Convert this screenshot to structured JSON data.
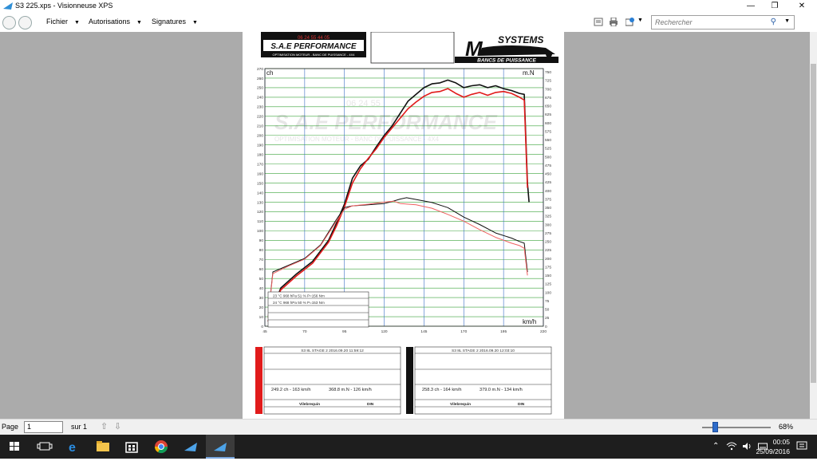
{
  "window": {
    "title": "S3 225.xps - Visionneuse XPS",
    "min_glyph": "—",
    "max_glyph": "❐",
    "close_glyph": "✕"
  },
  "menu": {
    "items": [
      {
        "label": "Fichier"
      },
      {
        "label": "Autorisations"
      },
      {
        "label": "Signatures"
      }
    ],
    "search_placeholder": "Rechercher"
  },
  "status": {
    "page_label": "Page",
    "page_value": "1",
    "of_label": "sur 1",
    "zoom": "68%"
  },
  "taskbar": {
    "time": "00:05",
    "date": "25/09/2016"
  },
  "document": {
    "logo_left_phone": "06 24 55 44 05",
    "logo_left_name": "S.A.E PERFORMANCE",
    "logo_left_sub": "OPTIMISATION MOTEUR - BANC DE PUISSANCE - 4X4",
    "logo_right_name": "SYSTEMS",
    "logo_right_sub": "BANCS DE PUISSANCE",
    "watermark_phone": "06 24 55",
    "watermark_name": "S.A.E PERFORMANCE",
    "watermark_sub": "OPTIMISATION MOTEUR - BANC DE PUISSANCE - 4X4",
    "conditions": [
      {
        "text": "23 °C    968 hPa    51 %      P=156 Nm"
      },
      {
        "text": "24 °C    968 hPa    50 %      P=153 Nm"
      }
    ],
    "run_cards": [
      {
        "color": "#e11b1b",
        "header": "S3 8L STAGE 2    2016.09.20 11:59:12",
        "result_power": "249.2 ch - 163 km/h",
        "result_torque": "368.8 m.N - 126 km/h",
        "footer_left": "Vilebrequin",
        "footer_right": "DIN"
      },
      {
        "color": "#111111",
        "header": "S3 8L STAGE 2    2016.09.20 12:03:10",
        "result_power": "258.3 ch - 164 km/h",
        "result_torque": "379.0 m.N - 134 km/h",
        "footer_left": "Vilebrequin",
        "footer_right": "DIN"
      }
    ]
  },
  "chart_data": {
    "type": "line",
    "xlabel": "km/h",
    "ylabel_left": "ch",
    "ylabel_right": "m.N",
    "xlim": [
      45,
      220
    ],
    "ylim_left": [
      0,
      270
    ],
    "ylim_right": [
      0,
      760
    ],
    "x_ticks": [
      45,
      70,
      95,
      120,
      145,
      170,
      195,
      220
    ],
    "y_ticks_left": [
      0,
      10,
      20,
      30,
      40,
      50,
      60,
      70,
      80,
      90,
      100,
      110,
      120,
      130,
      140,
      150,
      160,
      170,
      180,
      190,
      200,
      210,
      220,
      230,
      240,
      250,
      260,
      270
    ],
    "y_ticks_right": [
      0,
      25,
      50,
      75,
      100,
      125,
      150,
      175,
      200,
      225,
      250,
      275,
      300,
      325,
      350,
      375,
      400,
      425,
      450,
      475,
      500,
      525,
      550,
      575,
      600,
      625,
      650,
      675,
      700,
      725,
      750
    ],
    "grid": true,
    "series": [
      {
        "name": "258.3 ch",
        "axis": "left",
        "color": "#111111",
        "x": [
          47,
          55,
          65,
          75,
          85,
          90,
          95,
          100,
          105,
          110,
          115,
          120,
          125,
          130,
          135,
          140,
          145,
          150,
          155,
          160,
          165,
          170,
          175,
          180,
          185,
          190,
          195,
          200,
          205,
          208,
          210,
          211
        ],
        "values": [
          5,
          40,
          55,
          68,
          90,
          108,
          128,
          155,
          168,
          175,
          188,
          200,
          210,
          223,
          236,
          243,
          250,
          254,
          255,
          258,
          255,
          250,
          252,
          253,
          250,
          252,
          249,
          247,
          244,
          243,
          150,
          130
        ]
      },
      {
        "name": "249.2 ch",
        "axis": "left",
        "color": "#e11b1b",
        "x": [
          47,
          55,
          65,
          75,
          85,
          90,
          95,
          100,
          105,
          110,
          115,
          120,
          125,
          130,
          135,
          140,
          145,
          150,
          155,
          160,
          165,
          170,
          175,
          180,
          185,
          190,
          195,
          200,
          205,
          208,
          210
        ],
        "values": [
          5,
          38,
          53,
          66,
          88,
          105,
          125,
          150,
          165,
          176,
          186,
          198,
          208,
          218,
          228,
          235,
          241,
          245,
          246,
          249,
          244,
          240,
          243,
          245,
          242,
          245,
          246,
          244,
          240,
          237,
          145
        ]
      },
      {
        "name": "379.0 m.N",
        "axis": "right",
        "color": "#111111",
        "x": [
          47,
          50,
          60,
          70,
          80,
          90,
          95,
          100,
          110,
          120,
          125,
          130,
          134,
          140,
          150,
          160,
          170,
          180,
          190,
          200,
          205,
          208,
          210
        ],
        "values": [
          25,
          160,
          180,
          200,
          240,
          315,
          350,
          355,
          358,
          362,
          368,
          375,
          379,
          374,
          365,
          350,
          322,
          300,
          275,
          260,
          250,
          245,
          160
        ]
      },
      {
        "name": "368.8 m.N",
        "axis": "right",
        "color": "#f06060",
        "x": [
          47,
          50,
          60,
          70,
          80,
          90,
          95,
          100,
          110,
          120,
          126,
          130,
          140,
          150,
          160,
          170,
          180,
          190,
          200,
          205,
          208,
          210
        ],
        "values": [
          25,
          155,
          178,
          198,
          238,
          310,
          345,
          355,
          360,
          366,
          369,
          362,
          358,
          348,
          330,
          310,
          285,
          262,
          245,
          238,
          230,
          150
        ]
      }
    ]
  }
}
